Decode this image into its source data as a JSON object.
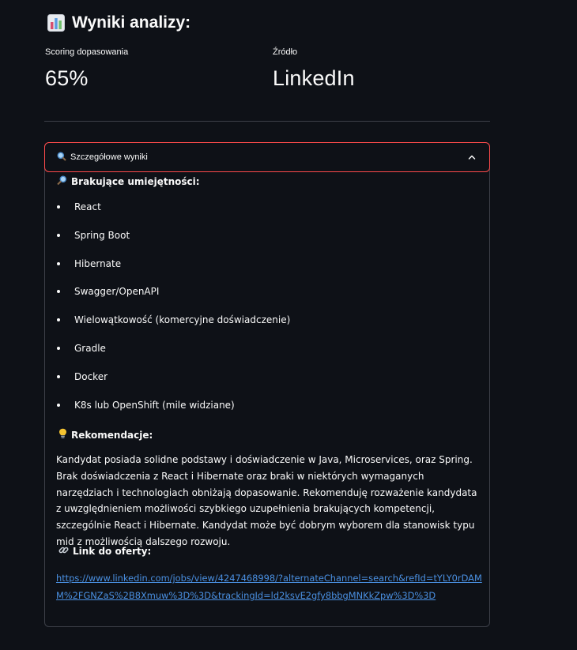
{
  "header": {
    "title_icon": "bar-chart-icon",
    "title": "Wyniki analizy:"
  },
  "metrics": {
    "score": {
      "label": "Scoring dopasowania",
      "value": "65%"
    },
    "source": {
      "label": "Źródło",
      "value": "LinkedIn"
    }
  },
  "expander": {
    "icon": "magnifier-icon",
    "label": "Szczegółowe wyniki",
    "expanded": true,
    "accent_color": "#ff4b4b",
    "missing_skills": {
      "icon": "magnifier-right-icon",
      "heading": "Brakujące umiejętności:",
      "items": [
        "React",
        "Spring Boot",
        "Hibernate",
        "Swagger/OpenAPI",
        "Wielowątkowość (komercyjne doświadczenie)",
        "Gradle",
        "Docker",
        "K8s lub OpenShift (mile widziane)"
      ]
    },
    "recommendations": {
      "icon": "lightbulb-icon",
      "heading": "Rekomendacje:",
      "text": "Kandydat posiada solidne podstawy i doświadczenie w Java, Microservices, oraz Spring. Brak doświadczenia z React i Hibernate oraz braki w niektórych wymaganych narzędziach i technologiach obniżają dopasowanie. Rekomenduję rozważenie kandydata z uwzględnieniem możliwości szybkiego uzupełnienia brakujących kompetencji, szczególnie React i Hibernate. Kandydat może być dobrym wyborem dla stanowisk typu mid z możliwością dalszego rozwoju."
    },
    "offer_link": {
      "icon": "link-icon",
      "heading": "Link do oferty:",
      "url": "https://www.linkedin.com/jobs/view/4247468998/?alternateChannel=search&refId=tYLY0rDAMM%2FGNZaS%2B8Xmuw%3D%3D&trackingId=ld2ksvE2gfy8bbgMNKkZpw%3D%3D"
    }
  }
}
